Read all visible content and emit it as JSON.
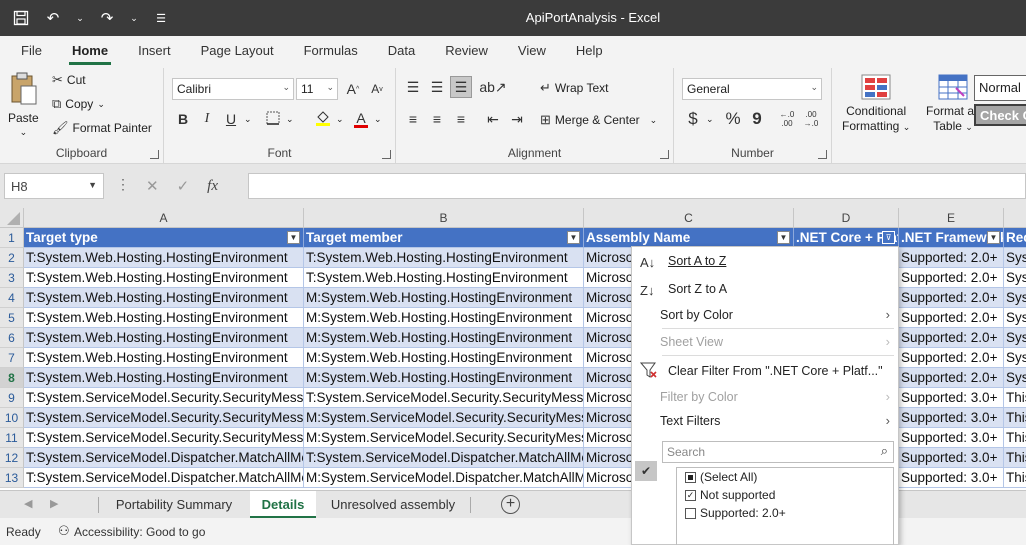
{
  "window": {
    "title": "ApiPortAnalysis  -  Excel"
  },
  "qat": {
    "save_icon": "save-icon",
    "undo_icon": "undo-icon",
    "redo_icon": "redo-icon"
  },
  "ribbon_tabs": [
    "File",
    "Home",
    "Insert",
    "Page Layout",
    "Formulas",
    "Data",
    "Review",
    "View",
    "Help"
  ],
  "active_tab": "Home",
  "clipboard": {
    "paste": "Paste",
    "cut": "Cut",
    "copy": "Copy",
    "format_painter": "Format Painter",
    "label": "Clipboard"
  },
  "font": {
    "name": "Calibri",
    "size": "11",
    "label": "Font",
    "bold": "B",
    "italic": "I",
    "underline": "U",
    "grow": "A",
    "shrink": "A",
    "font_color": "A"
  },
  "alignment": {
    "wrap": "Wrap Text",
    "merge": "Merge & Center",
    "label": "Alignment"
  },
  "number": {
    "format": "General",
    "currency": "$",
    "percent": "%",
    "comma": "9",
    "inc_decimal_top": "←.0",
    "inc_decimal_bottom": ".00",
    "dec_decimal_top": ".00",
    "dec_decimal_bottom": "→.0",
    "label": "Number"
  },
  "styles": {
    "conditional_line1": "Conditional",
    "conditional_line2": "Formatting",
    "format_table_line1": "Format as",
    "format_table_line2": "Table",
    "normal": "Normal",
    "check": "Check C"
  },
  "formula_bar": {
    "name_box": "H8",
    "cancel": "✕",
    "enter": "✓",
    "fx": "fx",
    "value": ""
  },
  "grid": {
    "columns": [
      "A",
      "B",
      "C",
      "D",
      "E"
    ],
    "row_numbers": [
      "1",
      "2",
      "3",
      "4",
      "5",
      "6",
      "7",
      "8",
      "9",
      "10",
      "11",
      "12",
      "13"
    ],
    "header": [
      "Target type",
      "Target member",
      "Assembly Name",
      ".NET Core + Platf...",
      ".NET Framework",
      "Recommended changes"
    ],
    "rows": [
      [
        "T:System.Web.Hosting.HostingEnvironment",
        "T:System.Web.Hosting.HostingEnvironment",
        "Microsoft",
        "",
        "Supported: 2.0+",
        "System"
      ],
      [
        "T:System.Web.Hosting.HostingEnvironment",
        "T:System.Web.Hosting.HostingEnvironment",
        "Microsoft",
        "",
        "Supported: 2.0+",
        "System"
      ],
      [
        "T:System.Web.Hosting.HostingEnvironment",
        "M:System.Web.Hosting.HostingEnvironment",
        "Microsoft",
        "",
        "Supported: 2.0+",
        "System"
      ],
      [
        "T:System.Web.Hosting.HostingEnvironment",
        "M:System.Web.Hosting.HostingEnvironment",
        "Microsoft",
        "",
        "Supported: 2.0+",
        "System"
      ],
      [
        "T:System.Web.Hosting.HostingEnvironment",
        "M:System.Web.Hosting.HostingEnvironment",
        "Microsoft",
        "",
        "Supported: 2.0+",
        "System"
      ],
      [
        "T:System.Web.Hosting.HostingEnvironment",
        "M:System.Web.Hosting.HostingEnvironment",
        "Microsoft",
        "",
        "Supported: 2.0+",
        "System"
      ],
      [
        "T:System.Web.Hosting.HostingEnvironment",
        "M:System.Web.Hosting.HostingEnvironment",
        "Microsoft",
        "",
        "Supported: 2.0+",
        "System"
      ],
      [
        "T:System.ServiceModel.Security.SecurityMessage",
        "T:System.ServiceModel.Security.SecurityMessage",
        "Microsoft",
        "",
        "Supported: 3.0+",
        "This"
      ],
      [
        "T:System.ServiceModel.Security.SecurityMessage",
        "M:System.ServiceModel.Security.SecurityMessage",
        "Microsoft",
        "",
        "Supported: 3.0+",
        "This"
      ],
      [
        "T:System.ServiceModel.Security.SecurityMessage",
        "M:System.ServiceModel.Security.SecurityMessage",
        "Microsoft",
        "",
        "Supported: 3.0+",
        "This"
      ],
      [
        "T:System.ServiceModel.Dispatcher.MatchAllMessageFilter",
        "T:System.ServiceModel.Dispatcher.MatchAllMessageFilter",
        "Microsoft",
        "",
        "Supported: 3.0+",
        "This"
      ],
      [
        "T:System.ServiceModel.Dispatcher.MatchAllMessageFilter",
        "M:System.ServiceModel.Dispatcher.MatchAllMessageFilter",
        "Microsoft",
        "",
        "Supported: 3.0+",
        "This"
      ]
    ]
  },
  "filter_menu": {
    "sort_az": "Sort A to Z",
    "sort_za": "Sort Z to A",
    "sort_color": "Sort by Color",
    "sheet_view": "Sheet View",
    "clear_filter": "Clear Filter From \".NET Core + Platf...\"",
    "filter_color": "Filter by Color",
    "text_filters": "Text Filters",
    "search_placeholder": "Search",
    "options": [
      {
        "label": "(Select All)",
        "state": "partial"
      },
      {
        "label": "Not supported",
        "state": "checked"
      },
      {
        "label": "Supported: 2.0+",
        "state": "unchecked"
      }
    ]
  },
  "sheets": [
    "Portability Summary",
    "Details",
    "Unresolved assembly"
  ],
  "active_sheet": "Details",
  "status": {
    "ready": "Ready",
    "accessibility": "Accessibility: Good to go"
  },
  "colors": {
    "accent": "#217346",
    "table_header": "#4472c4",
    "table_band": "#d9e1f2",
    "titlebar": "#3b3b3b"
  }
}
